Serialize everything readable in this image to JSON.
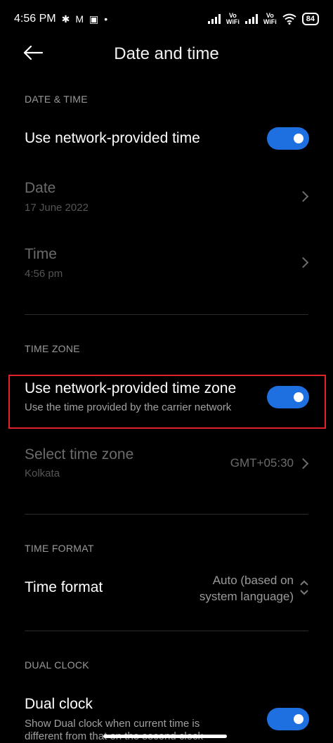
{
  "status": {
    "time": "4:56 PM",
    "vowifi1": [
      "Vo",
      "WiFi"
    ],
    "vowifi2": [
      "Vo",
      "WiFi"
    ],
    "battery": "84"
  },
  "appbar": {
    "title": "Date and time"
  },
  "date_time": {
    "header": "DATE & TIME",
    "network_time_label": "Use network-provided time",
    "network_time_on": true,
    "date_label": "Date",
    "date_value": "17 June 2022",
    "time_label": "Time",
    "time_value": "4:56 pm"
  },
  "time_zone": {
    "header": "TIME ZONE",
    "network_zone_label": "Use network-provided time zone",
    "network_zone_sub": "Use the time provided by the carrier network",
    "network_zone_on": true,
    "select_label": "Select time zone",
    "select_city": "Kolkata",
    "select_offset": "GMT+05:30"
  },
  "time_format": {
    "header": "TIME FORMAT",
    "label": "Time format",
    "value_line1": "Auto (based on",
    "value_line2": "system language)"
  },
  "dual_clock": {
    "header": "DUAL CLOCK",
    "label": "Dual clock",
    "sub_line1": "Show Dual clock when current time is",
    "sub_line2": "different from that on the second clock",
    "on": true
  },
  "colors": {
    "accent": "#1e6fe0",
    "highlight": "#e0222a"
  }
}
